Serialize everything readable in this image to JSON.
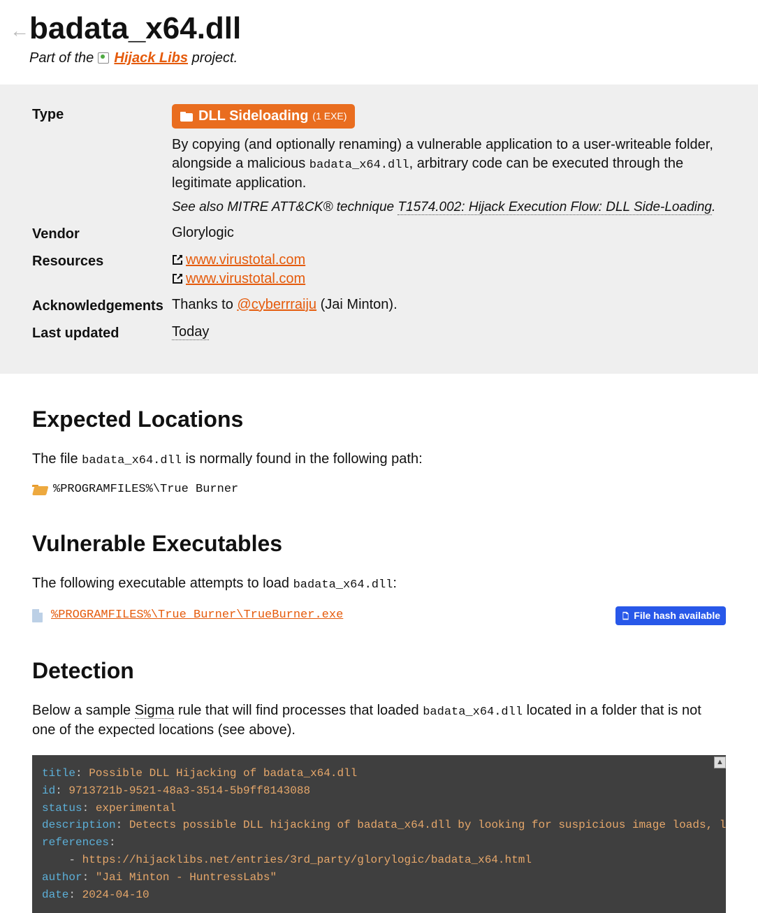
{
  "header": {
    "title": "badata_x64.dll",
    "subtitle_prefix": "Part of the ",
    "subtitle_link": "Hijack Libs",
    "subtitle_suffix": " project."
  },
  "info": {
    "type_label": "Type",
    "badge_text": "DLL Sideloading",
    "exe_count": "(1 EXE)",
    "desc_1": "By copying (and optionally renaming) a vulnerable application to a user-writeable folder, alongside a malicious ",
    "desc_code": "badata_x64.dll",
    "desc_2": ", arbitrary code can be executed through the legitimate application.",
    "see_also_prefix": "See also MITRE ATT&CK® technique ",
    "see_also_link": "T1574.002: Hijack Execution Flow: DLL Side-Loading",
    "vendor_label": "Vendor",
    "vendor": "Glorylogic",
    "resources_label": "Resources",
    "resources": [
      "www.virustotal.com",
      "www.virustotal.com"
    ],
    "ack_label": "Acknowledgements",
    "ack_prefix": "Thanks to ",
    "ack_handle": "@cyberrraiju",
    "ack_name": " (Jai Minton).",
    "updated_label": "Last updated",
    "updated_value": "Today"
  },
  "sections": {
    "locations_h": "Expected Locations",
    "locations_intro_1": "The file ",
    "locations_intro_code": "badata_x64.dll",
    "locations_intro_2": " is normally found in the following path:",
    "location_path": "%PROGRAMFILES%\\True Burner",
    "vuln_h": "Vulnerable Executables",
    "vuln_intro_1": "The following executable attempts to load ",
    "vuln_intro_code": "badata_x64.dll",
    "vuln_intro_2": ":",
    "vuln_path": "%PROGRAMFILES%\\True Burner\\TrueBurner.exe",
    "hash_badge": "File hash available",
    "detect_h": "Detection",
    "detect_intro_1": "Below a sample ",
    "detect_sigma": "Sigma",
    "detect_intro_2": " rule that will find processes that loaded ",
    "detect_code": "badata_x64.dll",
    "detect_intro_3": " located in a folder that is not one of the expected locations (see above)."
  },
  "sigma": {
    "title_k": "title",
    "title_v": "Possible DLL Hijacking of badata_x64.dll",
    "id_k": "id",
    "id_v": "9713721b-9521-48a3-3514-5b9ff8143088",
    "status_k": "status",
    "status_v": "experimental",
    "desc_k": "description",
    "desc_v": "Detects possible DLL hijacking of badata_x64.dll by looking for suspicious image loads, loading this DLL from unexpected locations.",
    "refs_k": "references",
    "refs_v": "https://hijacklibs.net/entries/3rd_party/glorylogic/badata_x64.html",
    "author_k": "author",
    "author_v": "\"Jai Minton - HuntressLabs\"",
    "date_k": "date",
    "date_v": "2024-04-10"
  }
}
